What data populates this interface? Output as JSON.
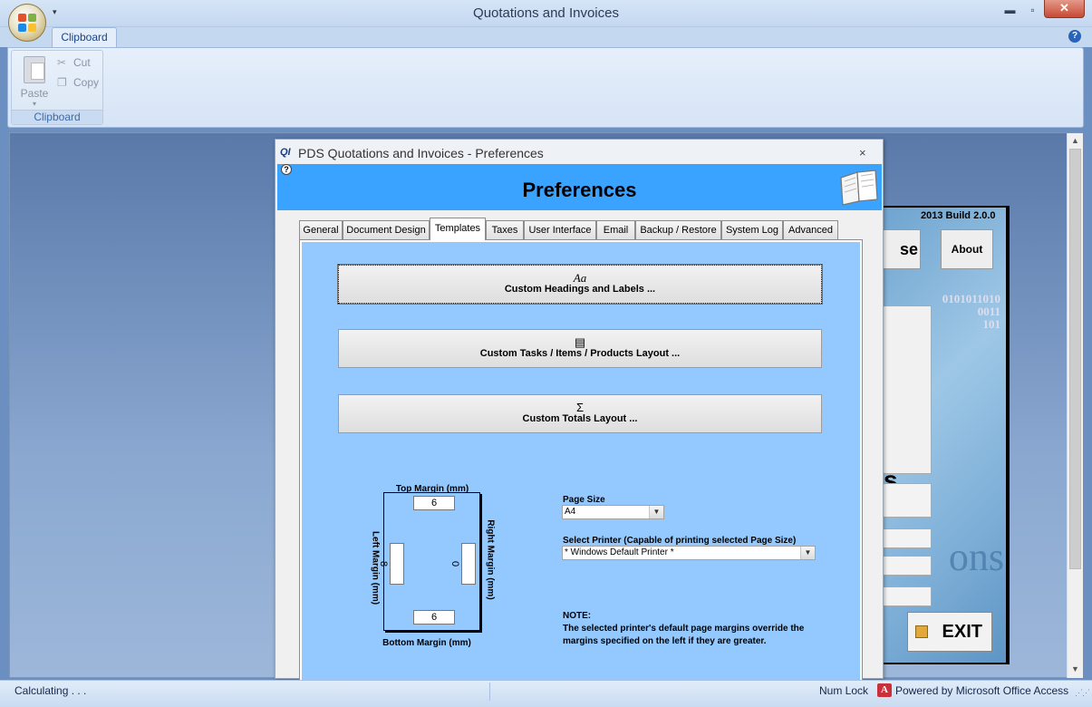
{
  "window": {
    "title": "Quotations and Invoices",
    "min_glyph": "▬",
    "max_glyph": "▫",
    "close_glyph": "✕"
  },
  "ribbon": {
    "tab_label": "Clipboard",
    "group_label": "Clipboard",
    "paste_label": "Paste",
    "cut_label": "Cut",
    "copy_label": "Copy",
    "help_glyph": "?"
  },
  "background_form": {
    "build_text": "2013 Build 2.0.0",
    "partial_button": "se",
    "about_label": "About",
    "binary_lines": [
      "0101011010",
      "0011",
      "101"
    ],
    "partial_letter": "s",
    "watermark_text": "ons",
    "exit_label": "EXIT"
  },
  "dialog": {
    "title": "PDS Quotations and Invoices - Preferences",
    "icon_text": "QI",
    "close_glyph": "×",
    "help_glyph": "?",
    "heading": "Preferences",
    "tabs": [
      "General",
      "Document Design",
      "Templates",
      "Taxes",
      "User Interface",
      "Email",
      "Backup / Restore",
      "System Log",
      "Advanced"
    ],
    "active_tab": "Templates",
    "buttons": [
      {
        "symbol": "Aa",
        "label": "Custom Headings and Labels ..."
      },
      {
        "symbol": "▤",
        "label": "Custom Tasks / Items / Products Layout ..."
      },
      {
        "symbol": "Σ",
        "label": "Custom Totals Layout ..."
      }
    ],
    "margins": {
      "top_label": "Top Margin (mm)",
      "bottom_label": "Bottom Margin (mm)",
      "left_label": "Left Margin (mm)",
      "right_label": "Right Margin (mm)",
      "top": "6",
      "bottom": "6",
      "left": "8",
      "right": "0"
    },
    "page_size_label": "Page Size",
    "page_size_value": "A4",
    "printer_label": "Select Printer (Capable of printing selected Page Size)",
    "printer_value": "* Windows Default Printer *",
    "note_title": "NOTE:",
    "note_text": "The selected printer's default page margins override the margins specified on the left if they are greater."
  },
  "statusbar": {
    "status": "Calculating . . .",
    "numlock": "Num Lock",
    "powered": "Powered by Microsoft Office Access",
    "access_icon_text": "A"
  },
  "colors": {
    "dialog_header": "#39a3ff",
    "tab_body": "#94c9ff",
    "ribbon": "#dbe7f6"
  }
}
